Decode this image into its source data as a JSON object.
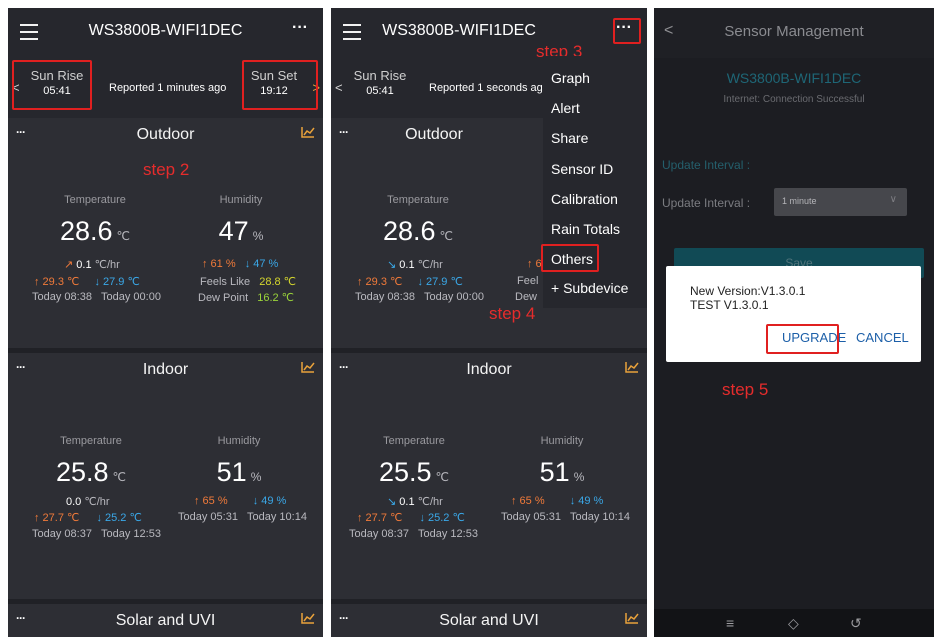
{
  "device_name": "WS3800B-WIFI1DEC",
  "screen1": {
    "sunrise": {
      "label": "Sun Rise",
      "time": "05:41"
    },
    "sunset": {
      "label": "Sun Set",
      "time": "19:12"
    },
    "reported": "Reported 1 minutes ago",
    "outdoor": {
      "title": "Outdoor",
      "temp_label": "Temperature",
      "temp_value": "28.6",
      "temp_unit": "℃",
      "hum_label": "Humidity",
      "hum_value": "47",
      "hum_unit": "%",
      "trend_arrow": "↗",
      "trend_value": "0.1",
      "trend_unit": "℃/hr",
      "hum_max": "↑ 61 %",
      "hum_min": "↓ 47 %",
      "temp_max": "↑ 29.3 ℃",
      "temp_min": "↓ 27.9 ℃",
      "feels_label": "Feels Like",
      "feels_value": "28.8 ℃",
      "time_max": "Today 08:38",
      "time_min": "Today 00:00",
      "dew_label": "Dew Point",
      "dew_value": "16.2 ℃"
    },
    "indoor": {
      "title": "Indoor",
      "temp_label": "Temperature",
      "temp_value": "25.8",
      "temp_unit": "℃",
      "hum_label": "Humidity",
      "hum_value": "51",
      "hum_unit": "%",
      "trend_value": "0.0",
      "trend_unit": "℃/hr",
      "hum_max": "↑ 65 %",
      "hum_min": "↓ 49 %",
      "temp_max": "↑ 27.7 ℃",
      "temp_min": "↓ 25.2 ℃",
      "hum_time_max": "Today 05:31",
      "hum_time_min": "Today 10:14",
      "time_max": "Today 08:37",
      "time_min": "Today 12:53"
    },
    "solar_title": "Solar and UVI"
  },
  "screen2": {
    "sunrise": {
      "label": "Sun Rise",
      "time": "05:41"
    },
    "reported": "Reported 1 seconds ag",
    "outdoor": {
      "title": "Outdoor",
      "temp_label": "Temperature",
      "temp_value": "28.6",
      "temp_unit": "℃",
      "trend_arrow": "↘",
      "trend_value": "0.1",
      "trend_unit": "℃/hr",
      "hum_max_partial": "↑ 6",
      "temp_max": "↑ 29.3 ℃",
      "temp_min": "↓ 27.9 ℃",
      "feels_partial": "Feel",
      "time_max": "Today 08:38",
      "time_min": "Today 00:00",
      "dew_partial": "Dew"
    },
    "indoor": {
      "title": "Indoor",
      "temp_label": "Temperature",
      "temp_value": "25.5",
      "temp_unit": "℃",
      "hum_label": "Humidity",
      "hum_value": "51",
      "hum_unit": "%",
      "trend_arrow": "↘",
      "trend_value": "0.1",
      "trend_unit": "℃/hr",
      "hum_max": "↑ 65 %",
      "hum_min": "↓ 49 %",
      "temp_max": "↑ 27.7 ℃",
      "temp_min": "↓ 25.2 ℃",
      "hum_time_max": "Today 05:31",
      "hum_time_min": "Today 10:14",
      "time_max": "Today 08:37",
      "time_min": "Today 12:53"
    },
    "solar_title": "Solar and UVI",
    "menu": [
      "Graph",
      "Alert",
      "Share",
      "Sensor ID",
      "Calibration",
      "Rain Totals",
      "Others",
      "+ Subdevice"
    ]
  },
  "screen3": {
    "title": "Sensor Management",
    "device": "WS3800B-WIFI1DEC",
    "internet": "Internet: Connection Successful",
    "section": "Update Interval :",
    "interval_label": "Update Interval :",
    "interval_value": "1 minute",
    "save_label": "Save",
    "dialog_line1": "New Version:V1.3.0.1",
    "dialog_line2": "TEST  V1.3.0.1",
    "upgrade_label": "UPGRADE",
    "cancel_label": "CANCEL"
  },
  "steps": {
    "step2": "step 2",
    "step3": "step 3",
    "step4": "step 4",
    "step5": "step 5"
  },
  "icons": {
    "menu": "hamburger-icon",
    "more": "more-dots-icon",
    "chart": "chart-icon",
    "back": "back-chevron-icon"
  },
  "colors": {
    "highlight": "#e02020",
    "step_text": "#e52c2c",
    "chart_icon": "#e9a23b",
    "high_value": "#f07a3a",
    "low_value": "#3aa8e8",
    "feels_like": "#d4d62e",
    "dew_point": "#9ad33a",
    "dialog_button": "#1c5fa8"
  }
}
